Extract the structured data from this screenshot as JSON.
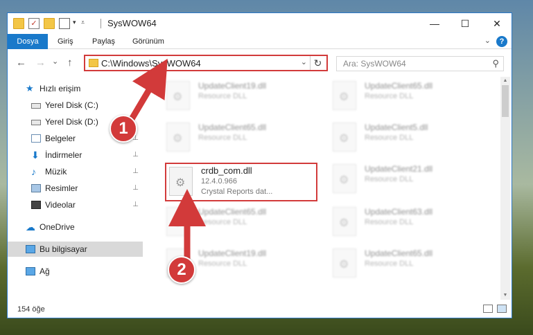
{
  "window": {
    "title": "SysWOW64",
    "minimize_glyph": "—",
    "maximize_glyph": "☐",
    "close_glyph": "✕"
  },
  "ribbon": {
    "tabs": [
      "Dosya",
      "Giriş",
      "Paylaş",
      "Görünüm"
    ],
    "expand_glyph": "⌄",
    "help_glyph": "?"
  },
  "nav": {
    "back_glyph": "←",
    "forward_glyph": "→",
    "history_glyph": "⌄",
    "up_glyph": "↑",
    "address": "C:\\Windows\\SysWOW64",
    "address_dropdown_glyph": "⌄",
    "refresh_glyph": "↻",
    "search_placeholder": "Ara: SysWOW64",
    "search_glyph": "⚲"
  },
  "sidebar": {
    "items": [
      {
        "label": "Hızlı erişim",
        "icon": "star-icon",
        "pinned": false
      },
      {
        "label": "Yerel Disk (C:)",
        "icon": "drive-icon",
        "pinned": false
      },
      {
        "label": "Yerel Disk (D:)",
        "icon": "drive-icon",
        "pinned": false
      },
      {
        "label": "Belgeler",
        "icon": "documents-icon",
        "pinned": true
      },
      {
        "label": "İndirmeler",
        "icon": "download-icon",
        "pinned": true
      },
      {
        "label": "Müzik",
        "icon": "music-icon",
        "pinned": true
      },
      {
        "label": "Resimler",
        "icon": "pictures-icon",
        "pinned": true
      },
      {
        "label": "Videolar",
        "icon": "videos-icon",
        "pinned": true
      },
      {
        "label": "OneDrive",
        "icon": "cloud-icon",
        "pinned": false
      },
      {
        "label": "Bu bilgisayar",
        "icon": "computer-icon",
        "pinned": false,
        "selected": true
      },
      {
        "label": "Ağ",
        "icon": "network-icon",
        "pinned": false
      }
    ],
    "pin_glyph": "📌"
  },
  "files": {
    "left_column": [
      {
        "name": "UpdateClient19.dll",
        "type": "Resource DLL"
      },
      {
        "name": "UpdateClient65.dll",
        "type": "Resource DLL"
      },
      {
        "name": "UpdateClient65.dll",
        "type": "Resource DLL"
      },
      {
        "name": "UpdateClient19.dll",
        "type": "Resource DLL"
      }
    ],
    "right_column": [
      {
        "name": "UpdateClient65.dll",
        "type": "Resource DLL"
      },
      {
        "name": "UpdateClient5.dll",
        "type": "Resource DLL"
      },
      {
        "name": "UpdateClient21.dll",
        "type": "Resource DLL"
      },
      {
        "name": "UpdateClient63.dll",
        "type": "Resource DLL"
      },
      {
        "name": "UpdateClient65.dll",
        "type": "Resource DLL"
      }
    ],
    "highlighted": {
      "name": "crdb_com.dll",
      "version": "12.4.0.966",
      "description": "Crystal Reports dat..."
    }
  },
  "status": {
    "item_count": "154 öğe"
  },
  "annotations": {
    "step1": "1",
    "step2": "2",
    "color": "#d23a3a"
  }
}
